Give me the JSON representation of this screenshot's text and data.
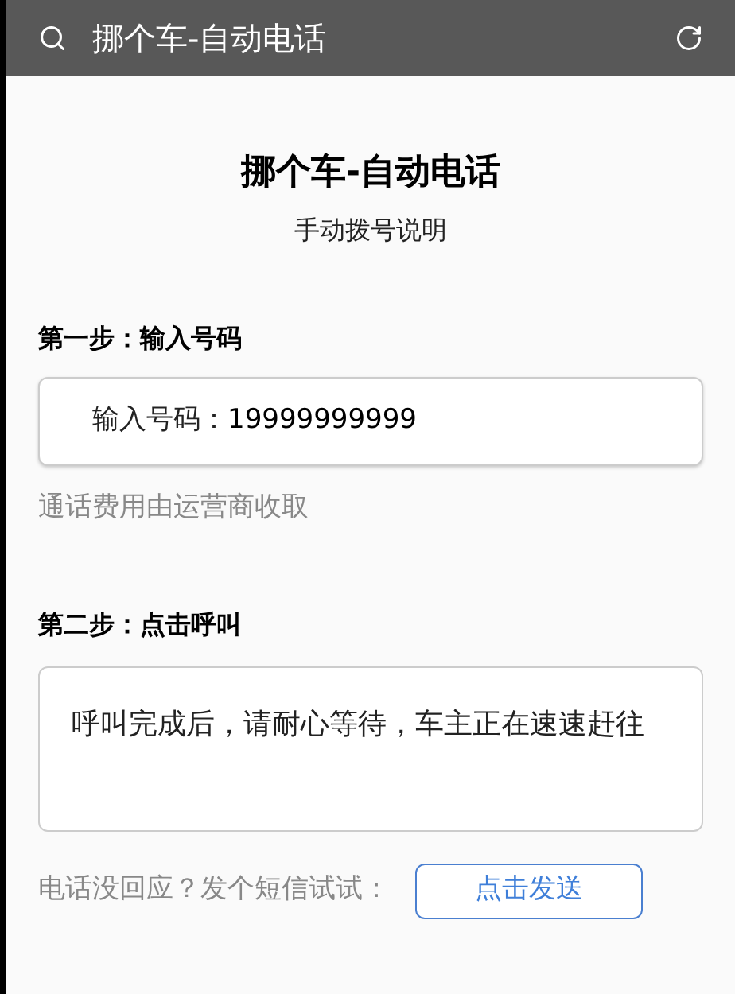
{
  "app_bar": {
    "title": "挪个车-自动电话"
  },
  "page": {
    "title": "挪个车-自动电话",
    "subtitle": "手动拨号说明"
  },
  "step1": {
    "heading": "第一步：输入号码",
    "field_label": "输入号码：",
    "value": "19999999999",
    "note": "通话费用由运营商收取"
  },
  "step2": {
    "heading": "第二步：点击呼叫",
    "message": "呼叫完成后，请耐心等待，车主正在速速赶往"
  },
  "sms": {
    "prompt": "电话没回应？发个短信试试：",
    "button": "点击发送"
  }
}
